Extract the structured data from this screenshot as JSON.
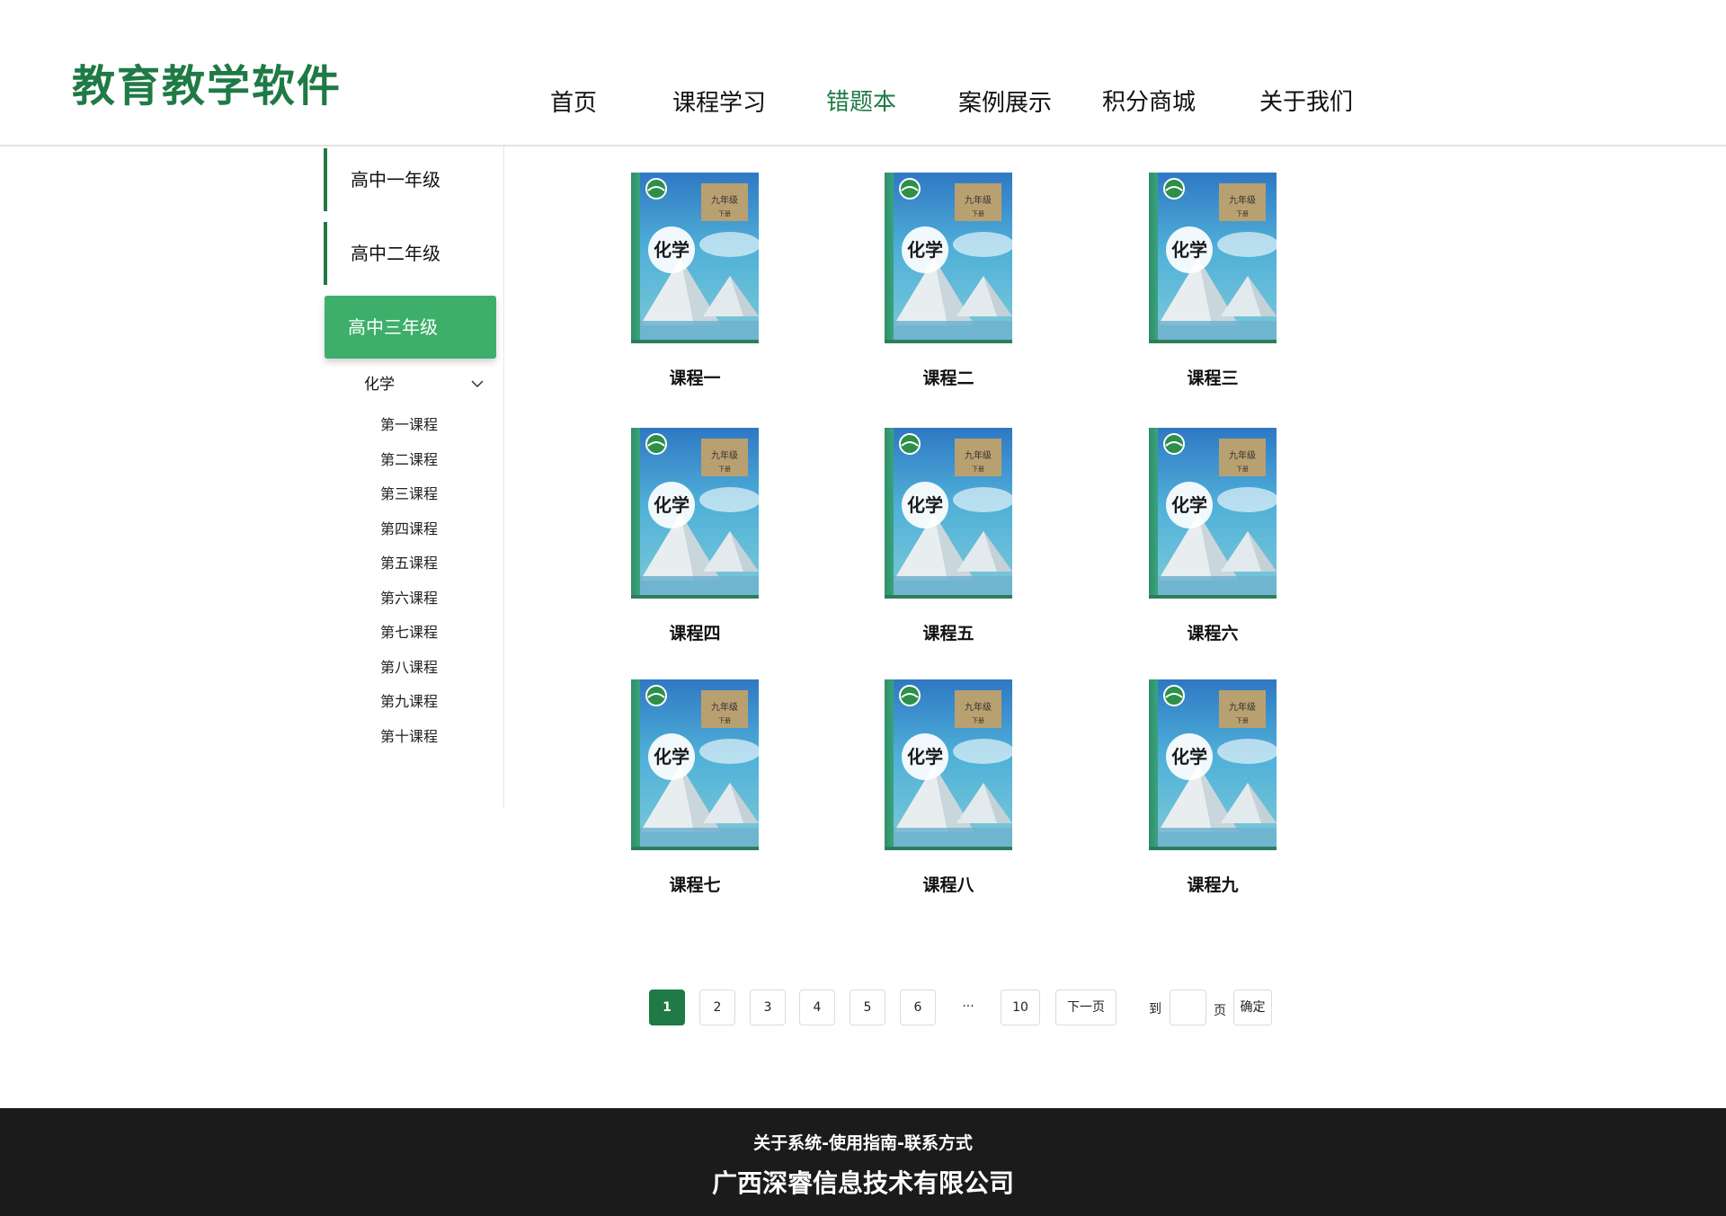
{
  "header": {
    "logo": "教育教学软件",
    "nav": [
      "首页",
      "课程学习",
      "错题本",
      "案例展示",
      "积分商城",
      "关于我们"
    ],
    "active_nav": "错题本"
  },
  "sidebar": {
    "grades": [
      "高中一年级",
      "高中二年级",
      "高中三年级"
    ],
    "active_grade": "高中三年级",
    "subject": "化学",
    "lessons": [
      "第一课程",
      "第二课程",
      "第三课程",
      "第四课程",
      "第五课程",
      "第六课程",
      "第七课程",
      "第八课程",
      "第九课程",
      "第十课程"
    ]
  },
  "courses": [
    {
      "title": "课程一",
      "book_title": "化学",
      "grade_label": "九年级",
      "volume_label": "下册"
    },
    {
      "title": "课程二",
      "book_title": "化学",
      "grade_label": "九年级",
      "volume_label": "下册"
    },
    {
      "title": "课程三",
      "book_title": "化学",
      "grade_label": "九年级",
      "volume_label": "下册"
    },
    {
      "title": "课程四",
      "book_title": "化学",
      "grade_label": "九年级",
      "volume_label": "下册"
    },
    {
      "title": "课程五",
      "book_title": "化学",
      "grade_label": "九年级",
      "volume_label": "下册"
    },
    {
      "title": "课程六",
      "book_title": "化学",
      "grade_label": "九年级",
      "volume_label": "下册"
    },
    {
      "title": "课程七",
      "book_title": "化学",
      "grade_label": "九年级",
      "volume_label": "下册"
    },
    {
      "title": "课程八",
      "book_title": "化学",
      "grade_label": "九年级",
      "volume_label": "下册"
    },
    {
      "title": "课程九",
      "book_title": "化学",
      "grade_label": "九年级",
      "volume_label": "下册"
    }
  ],
  "pagination": {
    "pages": [
      "1",
      "2",
      "3",
      "4",
      "5",
      "6"
    ],
    "ellipsis": "···",
    "last": "10",
    "next": "下一页",
    "goto_prefix": "到",
    "goto_suffix": "页",
    "confirm": "确定",
    "current": "1"
  },
  "footer": {
    "links": "关于系统-使用指南-联系方式",
    "company": "广西深睿信息技术有限公司"
  },
  "colors": {
    "brand": "#1f7a45",
    "active_grade_bg": "#3daf6b",
    "footer_bg": "#1b1b1b"
  }
}
